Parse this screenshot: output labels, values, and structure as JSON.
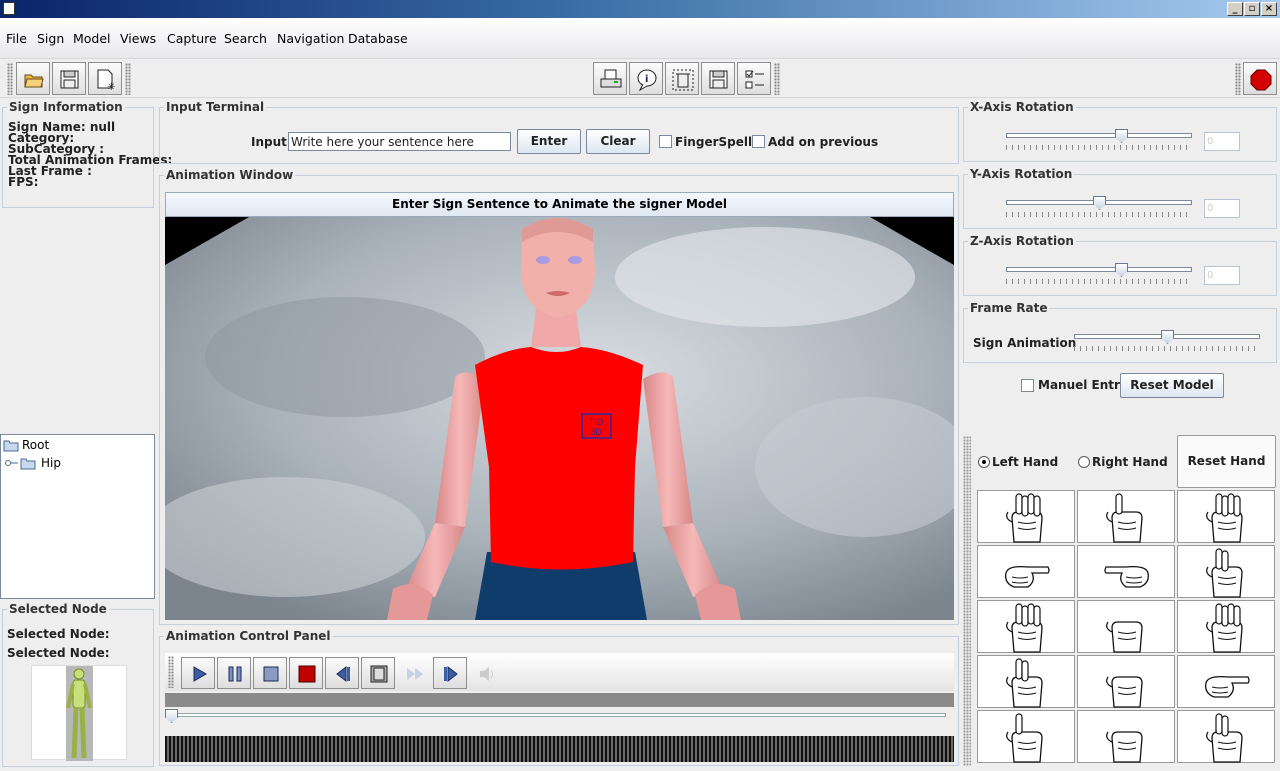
{
  "window": {
    "title": ""
  },
  "menu": [
    "File",
    "Sign",
    "Model",
    "Views",
    "Capture",
    "Search",
    "Navigation",
    "Database"
  ],
  "toolbar": {
    "left_icons": [
      "open-folder-icon",
      "save-icon",
      "new-document-icon"
    ],
    "center_icons": [
      "print-icon",
      "info-icon",
      "delete-icon",
      "save-icon",
      "checklist-icon"
    ],
    "right_icons": [
      "stop-icon"
    ]
  },
  "sign_info": {
    "title": "Sign Information",
    "lines": [
      "Sign Name: null",
      "Category:",
      "SubCategory :",
      "Total Animation Frames:",
      "Last Frame :",
      "FPS:"
    ]
  },
  "tree": {
    "root": "Root",
    "child": "Hip"
  },
  "selected_node": {
    "title": "Selected Node",
    "line1": "Selected Node:",
    "line2": "Selected Node:"
  },
  "input_terminal": {
    "title": "Input Terminal",
    "input_label": "Input:",
    "input_value": "Write here your sentence here",
    "enter": "Enter",
    "clear": "Clear",
    "fingerspell": "FingerSpell",
    "add_on_previous": "Add on previous"
  },
  "animation_window": {
    "title": "Animation Window",
    "header": "Enter Sign Sentence to Animate the signer Model",
    "shirt_logo_line1": "TID",
    "shirt_logo_line2": "3D"
  },
  "control_panel": {
    "title": "Animation Control Panel",
    "buttons": [
      "play-icon",
      "pause-icon",
      "stop-icon",
      "record-icon",
      "step-back-icon",
      "film-icon",
      "fast-forward-icon",
      "step-forward-icon",
      "volume-icon"
    ],
    "progress": 0.0
  },
  "rotation": {
    "x": {
      "title": "X-Axis Rotation",
      "value": "0",
      "level": 0.63
    },
    "y": {
      "title": "Y-Axis Rotation",
      "value": "0",
      "level": 0.5
    },
    "z": {
      "title": "Z-Axis Rotation",
      "value": "0",
      "level": 0.63
    }
  },
  "frame_rate": {
    "title": "Frame Rate",
    "label": "Sign Animation",
    "level": 0.5
  },
  "manual_entry": "Manuel Entry",
  "reset_model": "Reset Model",
  "hands": {
    "left": "Left Hand",
    "right": "Right Hand",
    "reset": "Reset Hand",
    "selected": "left"
  },
  "colors": {
    "shirt": "#ff0000",
    "skin": "#f2a7a7",
    "pants": "#0f3c6a",
    "header_bg": "#e6eef8"
  }
}
